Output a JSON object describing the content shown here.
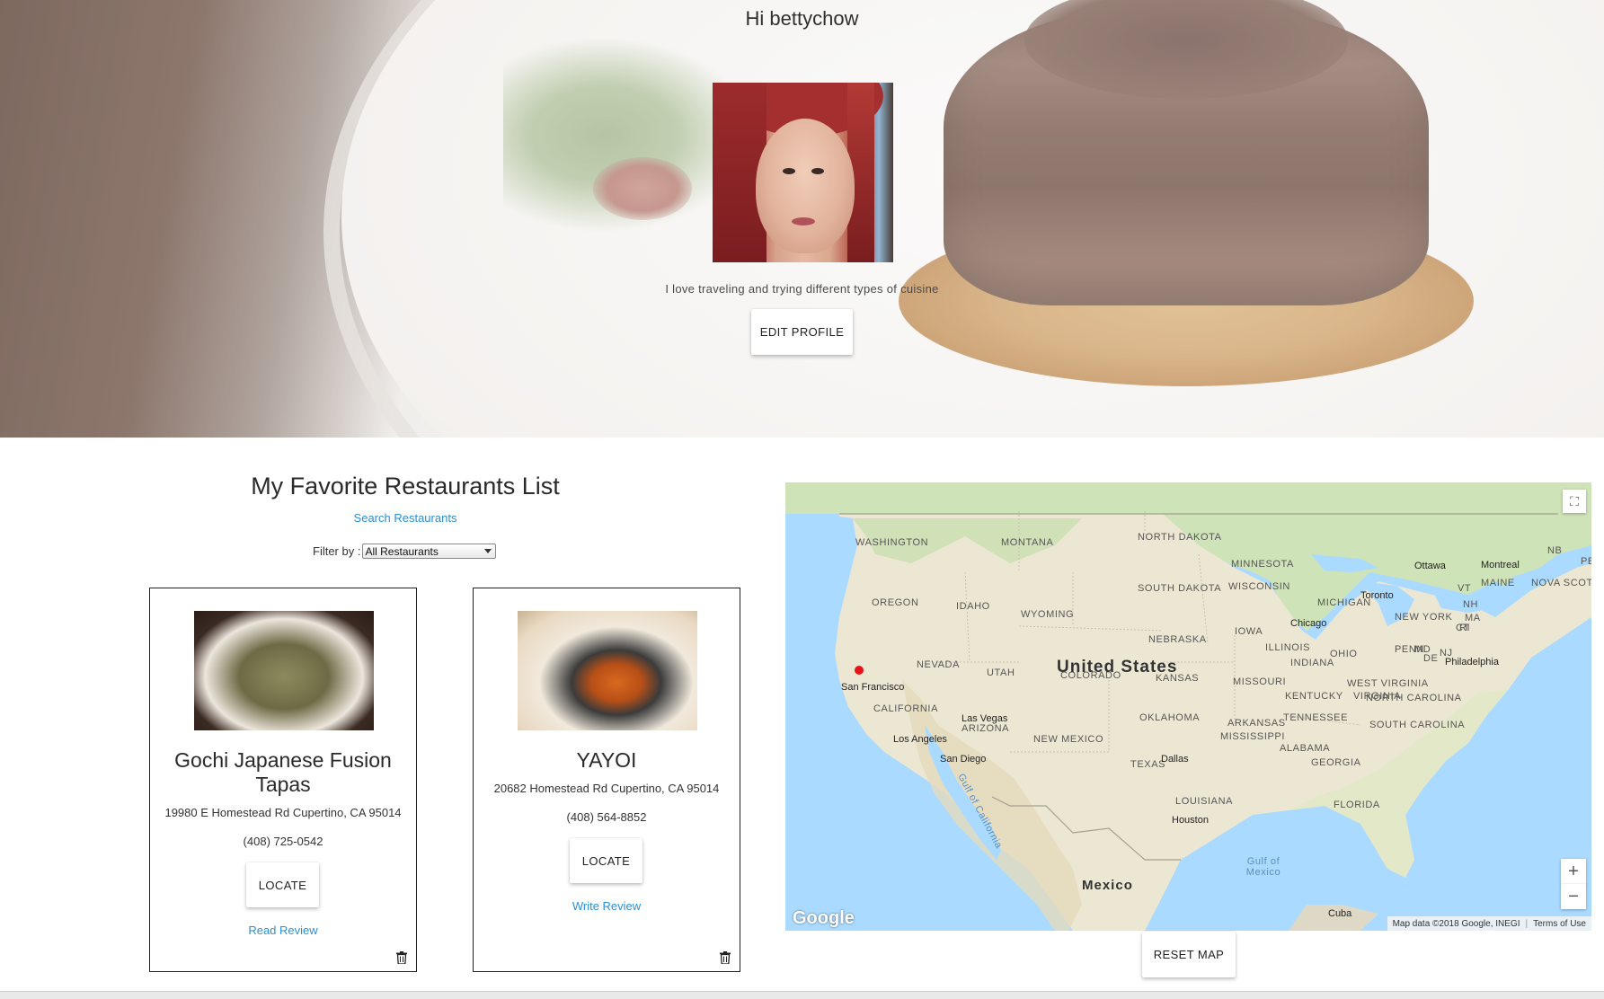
{
  "header": {
    "greeting": "Hi bettychow",
    "bio": "I love traveling and trying different types of cuisine",
    "edit_profile_label": "EDIT PROFILE"
  },
  "favorites": {
    "title": "My Favorite Restaurants List",
    "search_link": "Search Restaurants",
    "filter_label": "Filter by :",
    "filter_value": "All Restaurants",
    "restaurants": [
      {
        "name": "Gochi Japanese Fusion Tapas",
        "address": "19980 E Homestead Rd Cupertino, CA 95014",
        "phone": "(408) 725-0542",
        "locate_label": "LOCATE",
        "review_link": "Read Review"
      },
      {
        "name": "YAYOI",
        "address": "20682 Homestead Rd Cupertino, CA 95014",
        "phone": "(408) 564-8852",
        "locate_label": "LOCATE",
        "review_link": "Write Review"
      }
    ]
  },
  "map": {
    "country": "United States",
    "mexico": "Mexico",
    "states": [
      "WASHINGTON",
      "MONTANA",
      "NORTH DAKOTA",
      "MINNESOTA",
      "OREGON",
      "IDAHO",
      "SOUTH DAKOTA",
      "WYOMING",
      "WISCONSIN",
      "MICHIGAN",
      "NEBRASKA",
      "IOWA",
      "ILLINOIS",
      "OHIO",
      "PENN",
      "NEVADA",
      "UTAH",
      "COLORADO",
      "KANSAS",
      "MISSOURI",
      "INDIANA",
      "CALIFORNIA",
      "KENTUCKY",
      "VIRGINIA",
      "OKLAHOMA",
      "ARKANSAS",
      "TENNESSEE",
      "ARIZONA",
      "NEW MEXICO",
      "MISSISSIPPI",
      "ALABAMA",
      "GEORGIA",
      "TEXAS",
      "LOUISIANA",
      "FLORIDA",
      "NORTH CAROLINA",
      "SOUTH CAROLINA",
      "WEST VIRGINIA",
      "NEW YORK",
      "MAINE",
      "NB",
      "PE",
      "NOVA SCOT",
      "VT",
      "NH",
      "MA",
      "CT",
      "RI",
      "MD",
      "DE",
      "NJ"
    ],
    "cities": [
      "San Francisco",
      "Los Angeles",
      "San Diego",
      "Las Vegas",
      "Chicago",
      "Dallas",
      "Houston",
      "Toronto",
      "Ottawa",
      "Montreal",
      "Philadelphia",
      "Cuba"
    ],
    "water": [
      "Gulf of Mexico",
      "Gulf of California"
    ],
    "attribution": "Map data ©2018 Google, INEGI",
    "terms": "Terms of Use",
    "logo": "Google",
    "zoom_in": "+",
    "zoom_out": "−",
    "reset_label": "RESET MAP"
  }
}
